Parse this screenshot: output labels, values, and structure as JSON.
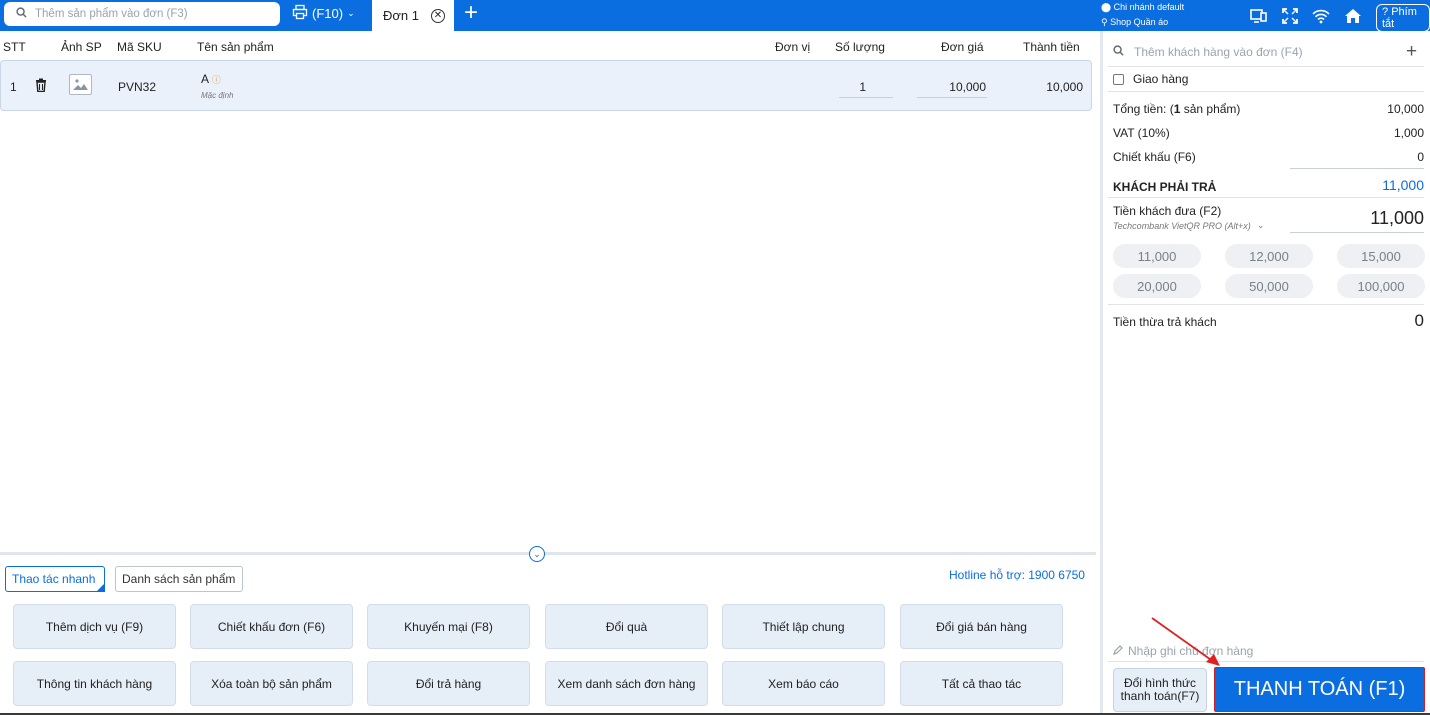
{
  "topbar": {
    "search_placeholder": "Thêm sản phẩm vào đơn (F3)",
    "printer_label": "(F10)",
    "active_tab": "Đơn 1",
    "branch": "Chi nhánh default",
    "shop": "Shop Quần áo",
    "hotkey_label": "Phím tắt",
    "accent": "#0b6ee0"
  },
  "table": {
    "headers": [
      "STT",
      "Ảnh SP",
      "Mã SKU",
      "Tên sản phẩm",
      "Đơn vị",
      "Số lượng",
      "Đơn giá",
      "Thành tiền"
    ],
    "rows": [
      {
        "stt": "1",
        "sku": "PVN32",
        "name": "A",
        "variant": "Mặc định",
        "qty": "1",
        "price": "10,000",
        "total": "10,000"
      }
    ]
  },
  "bottom": {
    "tabs": [
      "Thao tác nhanh",
      "Danh sách sản phẩm"
    ],
    "hotline": "Hotline hỗ trợ: 1900 6750",
    "actions": [
      "Thêm dịch vụ (F9)",
      "Chiết khấu đơn (F6)",
      "Khuyến mại (F8)",
      "Đổi quà",
      "Thiết lập chung",
      "Đổi giá bán hàng",
      "Thông tin khách hàng",
      "Xóa toàn bộ sản phẩm",
      "Đổi trả hàng",
      "Xem danh sách đơn hàng",
      "Xem báo cáo",
      "Tất cả thao tác"
    ]
  },
  "panel": {
    "customer_placeholder": "Thêm khách hàng vào đơn (F4)",
    "delivery_label": "Giao hàng",
    "total_label_a": "Tổng tiền: (",
    "total_count": "1",
    "total_label_b": " sản phẩm)",
    "total_value": "10,000",
    "vat_label": "VAT (10%)",
    "vat_value": "1,000",
    "discount_label": "Chiết khấu (F6)",
    "discount_value": "0",
    "due_label": "KHÁCH PHẢI TRẢ",
    "due_value": "11,000",
    "paid_label": "Tiền khách đưa (F2)",
    "paid_method": "Techcombank VietQR PRO (Alt+x)",
    "paid_value": "11,000",
    "suggestions": [
      "11,000",
      "12,000",
      "15,000",
      "20,000",
      "50,000",
      "100,000"
    ],
    "change_label": "Tiền thừa trả khách",
    "change_value": "0",
    "note_placeholder": "Nhập ghi chú đơn hàng",
    "change_method_l1": "Đổi hình thức",
    "change_method_l2": "thanh toán(F7)",
    "pay_label": "THANH TOÁN (F1)"
  }
}
